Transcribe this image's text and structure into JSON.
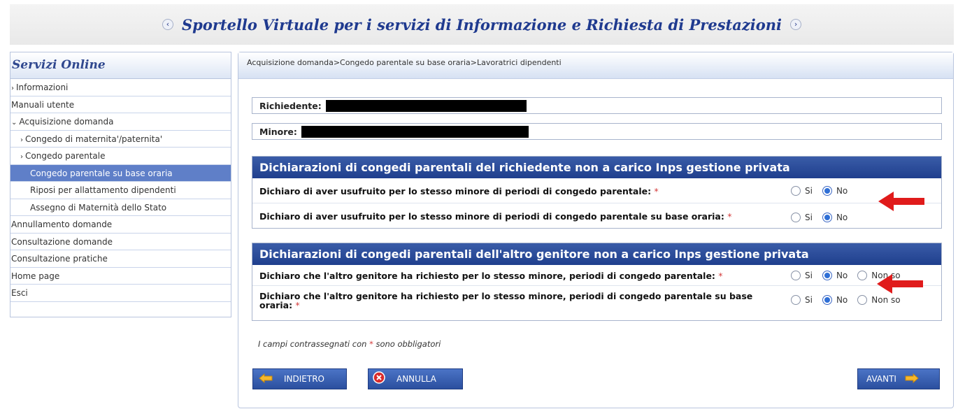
{
  "header": {
    "title": "Sportello Virtuale per i servizi di Informazione e Richiesta di Prestazioni"
  },
  "sidebar": {
    "title": "Servizi Online",
    "items": [
      {
        "label": "Informazioni",
        "level": 1,
        "chevron": "›"
      },
      {
        "label": "Manuali utente",
        "level": 1,
        "chevron": ""
      },
      {
        "label": "Acquisizione domanda",
        "level": 1,
        "chevron": "⌄"
      },
      {
        "label": "Congedo di maternita'/paternita'",
        "level": 2,
        "chevron": "›"
      },
      {
        "label": "Congedo parentale",
        "level": 2,
        "chevron": "›"
      },
      {
        "label": "Congedo parentale su base oraria",
        "level": 2,
        "chevron": "",
        "active": true
      },
      {
        "label": "Riposi per allattamento dipendenti",
        "level": 3,
        "chevron": ""
      },
      {
        "label": "Assegno di Maternità dello Stato",
        "level": 3,
        "chevron": ""
      },
      {
        "label": "Annullamento domande",
        "level": 1,
        "chevron": ""
      },
      {
        "label": "Consultazione domande",
        "level": 1,
        "chevron": ""
      },
      {
        "label": "Consultazione pratiche",
        "level": 1,
        "chevron": ""
      },
      {
        "label": "Home page",
        "level": 1,
        "chevron": ""
      },
      {
        "label": "Esci",
        "level": 1,
        "chevron": ""
      }
    ]
  },
  "breadcrumb": "Acquisizione domanda>Congedo parentale su base oraria>Lavoratrici dipendenti",
  "applicant": {
    "label": "Richiedente:"
  },
  "minor": {
    "label": "Minore:"
  },
  "section1": {
    "title": "Dichiarazioni di congedi parentali del richiedente non a carico Inps gestione privata",
    "questions": [
      {
        "text": "Dichiaro di aver usufruito per lo stesso minore di periodi di congedo parentale:",
        "required": "*",
        "options": [
          "Si",
          "No"
        ],
        "selected": "No"
      },
      {
        "text": "Dichiaro di aver usufruito per lo stesso minore di periodi di congedo parentale su base oraria:",
        "required": "*",
        "options": [
          "Si",
          "No"
        ],
        "selected": "No"
      }
    ]
  },
  "section2": {
    "title": "Dichiarazioni di congedi parentali dell'altro genitore non a carico Inps gestione privata",
    "questions": [
      {
        "text": "Dichiaro che l'altro genitore ha richiesto per lo stesso minore, periodi di congedo parentale:",
        "required": "*",
        "options": [
          "Si",
          "No",
          "Non so"
        ],
        "selected": "No"
      },
      {
        "text": "Dichiaro che l'altro genitore ha richiesto per lo stesso minore, periodi di congedo parentale su base oraria:",
        "required": "*",
        "options": [
          "Si",
          "No",
          "Non so"
        ],
        "selected": "No"
      }
    ]
  },
  "note": {
    "prefix": "I campi contrassegnati con",
    "star": "*",
    "suffix": "sono obbligatori"
  },
  "buttons": {
    "back": "INDIETRO",
    "cancel": "ANNULLA",
    "next": "AVANTI"
  },
  "icons": {
    "back": "arrow-left-icon",
    "cancel": "cancel-icon",
    "next": "arrow-right-icon"
  },
  "colors": {
    "accent": "#2b4f9f",
    "active_item": "#5f7fc8",
    "required": "#d43a3a",
    "annotation_arrow": "#e01b1b"
  }
}
